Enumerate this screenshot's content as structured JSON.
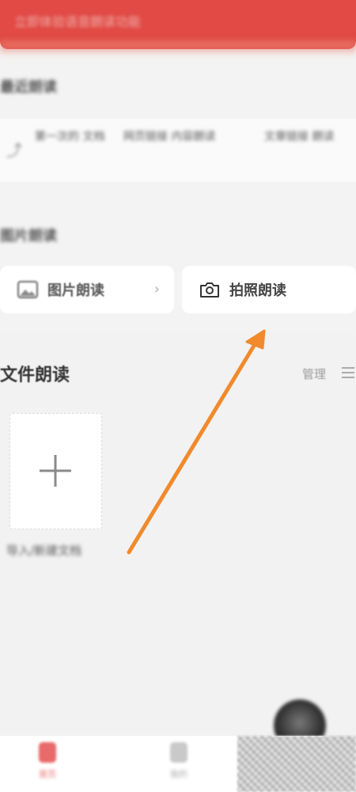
{
  "banner": {
    "text": "立即体验语音朗读功能"
  },
  "recent": {
    "title": "最近朗读",
    "items": [
      "第一次的 文档",
      "网页链接 内容朗读",
      "文章链接 朗读"
    ]
  },
  "image_read": {
    "title": "图片朗读",
    "picture_label": "图片朗读",
    "photo_label": "拍照朗读"
  },
  "files": {
    "title": "文件朗读",
    "manage_label": "管理",
    "add_caption": "导入/新建文档"
  },
  "nav": {
    "home_label": "首页",
    "mine_label": "我的"
  },
  "colors": {
    "accent": "#e14a45",
    "arrow": "#f08a2c"
  }
}
